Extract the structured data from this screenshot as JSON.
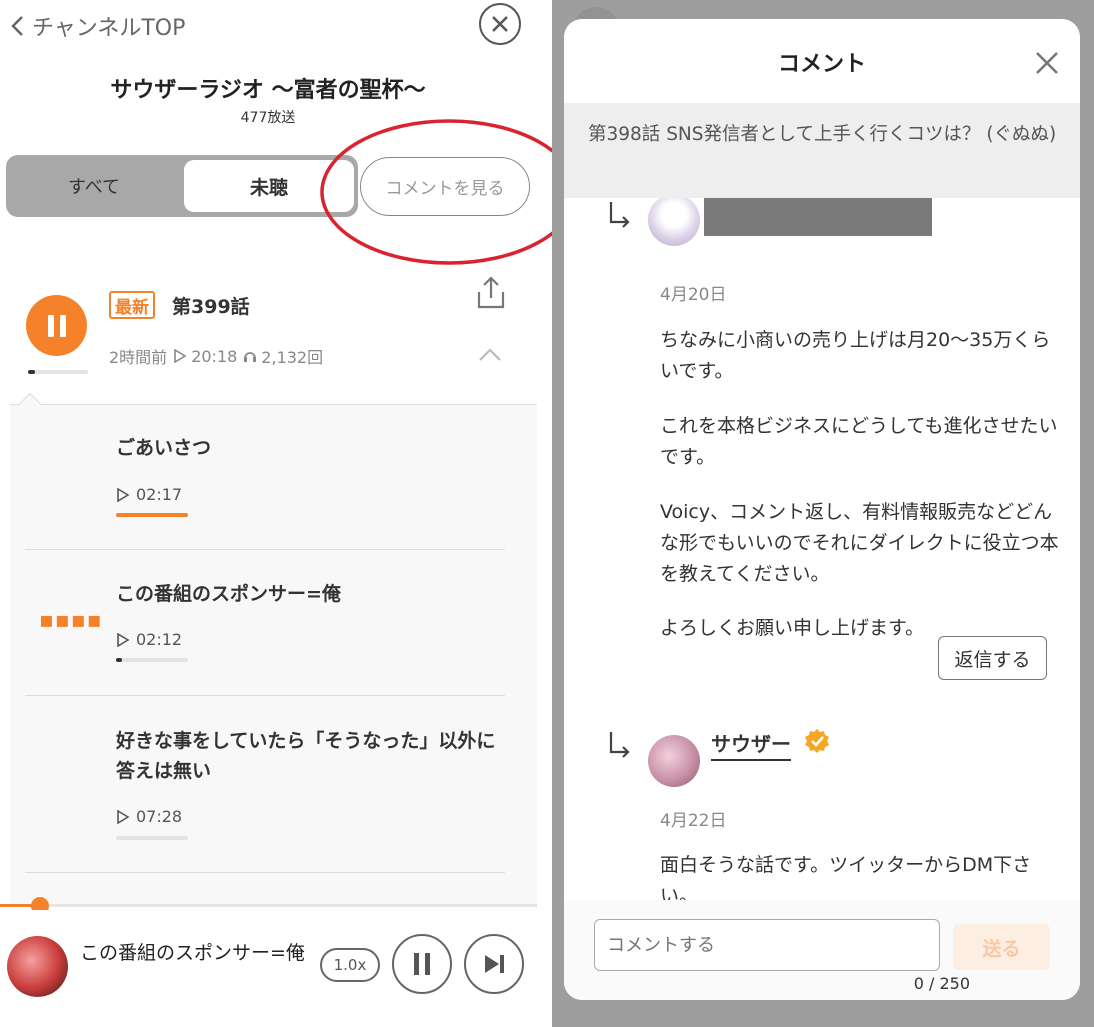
{
  "header": {
    "back_label": "チャンネルTOP",
    "channel_title": "サウザーラジオ 〜富者の聖杯〜",
    "broadcast_count": "477放送"
  },
  "tabs": {
    "all": "すべて",
    "unheard": "未聴",
    "view_comments": "コメントを見る"
  },
  "episode": {
    "badge": "最新",
    "number": "第399話",
    "posted": "2時間前",
    "duration": "20:18",
    "plays": "2,132回",
    "progress": 0.12
  },
  "chapters": [
    {
      "title": "ごあいさつ",
      "duration": "02:17",
      "progress": 1.0,
      "playing": false
    },
    {
      "title": "この番組のスポンサー=俺",
      "duration": "02:12",
      "progress": 0.08,
      "playing": true
    },
    {
      "title": "好きな事をしていたら「そうなった」以外に答えは無い",
      "duration": "07:28",
      "progress": 0,
      "playing": false
    }
  ],
  "player": {
    "now_playing": "この番組のスポンサー=俺",
    "speed": "1.0x",
    "position": 0.075
  },
  "modal": {
    "title": "コメント",
    "episode_title": "第398話 SNS発信者として上手く行くコツは？ (ぐぬぬ)",
    "reply1": {
      "date": "4月20日",
      "paragraphs": [
        "ちなみに小商いの売り上げは月20〜35万くらいです。",
        "これを本格ビジネスにどうしても進化させたいです。",
        "Voicy、コメント返し、有料情報販売などどんな形でもいいのでそれにダイレクトに役立つ本を教えてください。",
        "よろしくお願い申し上げます。"
      ],
      "reply_button": "返信する"
    },
    "reply2": {
      "username": "サウザー",
      "date": "4月22日",
      "text": "面白そうな話です。ツイッターからDM下さい。"
    },
    "comment_placeholder": "コメントする",
    "send_label": "送る",
    "char_counter": "0 / 250"
  },
  "colors": {
    "accent": "#f5822a",
    "highlight_ring": "#d9232e",
    "overlay": "#9e9e9e",
    "verified": "#f5a623"
  }
}
